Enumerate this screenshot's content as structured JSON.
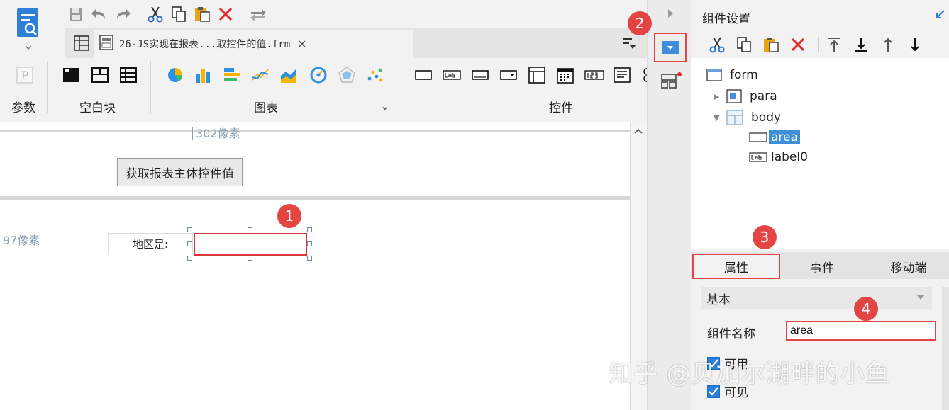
{
  "document_tab": {
    "title": "26-JS实现在报表...取控件的值.frm",
    "close": "✕"
  },
  "ribbon": {
    "groups": [
      {
        "label": "参数"
      },
      {
        "label": "空白块"
      },
      {
        "label": "图表"
      },
      {
        "label": "控件"
      }
    ],
    "param_icon_text": "P",
    "chart_expand": "⌄"
  },
  "canvas": {
    "width_ruler": "302像素",
    "height_ruler": "97像素",
    "button_label": "获取报表主体控件值",
    "area_label": "地区是:"
  },
  "markers": [
    "1",
    "2",
    "3",
    "4"
  ],
  "right_panel": {
    "title": "组件设置",
    "tree": [
      {
        "label": "form"
      },
      {
        "label": "para"
      },
      {
        "label": "body"
      },
      {
        "label": "area"
      },
      {
        "label": "label0"
      }
    ],
    "tabs": [
      "属性",
      "事件",
      "移动端"
    ],
    "section": "基本",
    "name_label": "组件名称",
    "name_value": "area",
    "checkbox_enabled": "可用",
    "checkbox_visible": "可见"
  },
  "watermark": "知乎 @贝加尔湖畔的小鱼",
  "colors": {
    "accent_red": "#e34544",
    "select_blue": "#3f8fd8"
  }
}
